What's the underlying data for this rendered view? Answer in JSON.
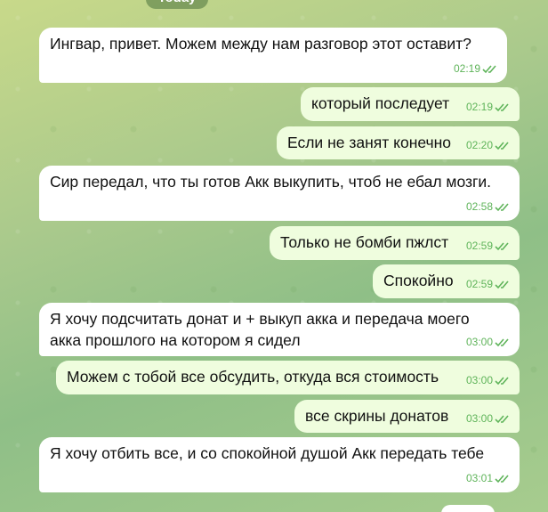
{
  "chat": {
    "date_label": "Today",
    "messages": [
      {
        "text": "Ингвар, привет. Можем между нам разговор этот оставит?",
        "time": "02:19",
        "side": "in"
      },
      {
        "text": "который последует",
        "time": "02:19",
        "side": "out"
      },
      {
        "text": "Если не занят конечно",
        "time": "02:20",
        "side": "out"
      },
      {
        "text": "Сир передал, что ты готов Акк выкупить, чтоб не ебал мозги.",
        "time": "02:58",
        "side": "in"
      },
      {
        "text": "Только не бомби пжлст",
        "time": "02:59",
        "side": "out"
      },
      {
        "text": "Спокойно",
        "time": "02:59",
        "side": "out"
      },
      {
        "text": "Я хочу подсчитать донат и + выкуп акка и передача моего\nакка прошлого на котором я сидел",
        "time": "03:00",
        "side": "in"
      },
      {
        "text": "Можем с тобой все обсудить, откуда вся стоимость",
        "time": "03:00",
        "side": "out"
      },
      {
        "text": "все скрины донатов",
        "time": "03:00",
        "side": "out"
      },
      {
        "text": "Я хочу отбить все, и со спокойной душой Акк передать тебе",
        "time": "03:01",
        "side": "in"
      }
    ],
    "colors": {
      "incoming_bubble": "#ffffff",
      "outgoing_bubble": "#effdde",
      "timestamp": "#5fb45a",
      "read_check": "#5fb45a"
    },
    "icons": {
      "read_status": "double-check-icon"
    }
  }
}
